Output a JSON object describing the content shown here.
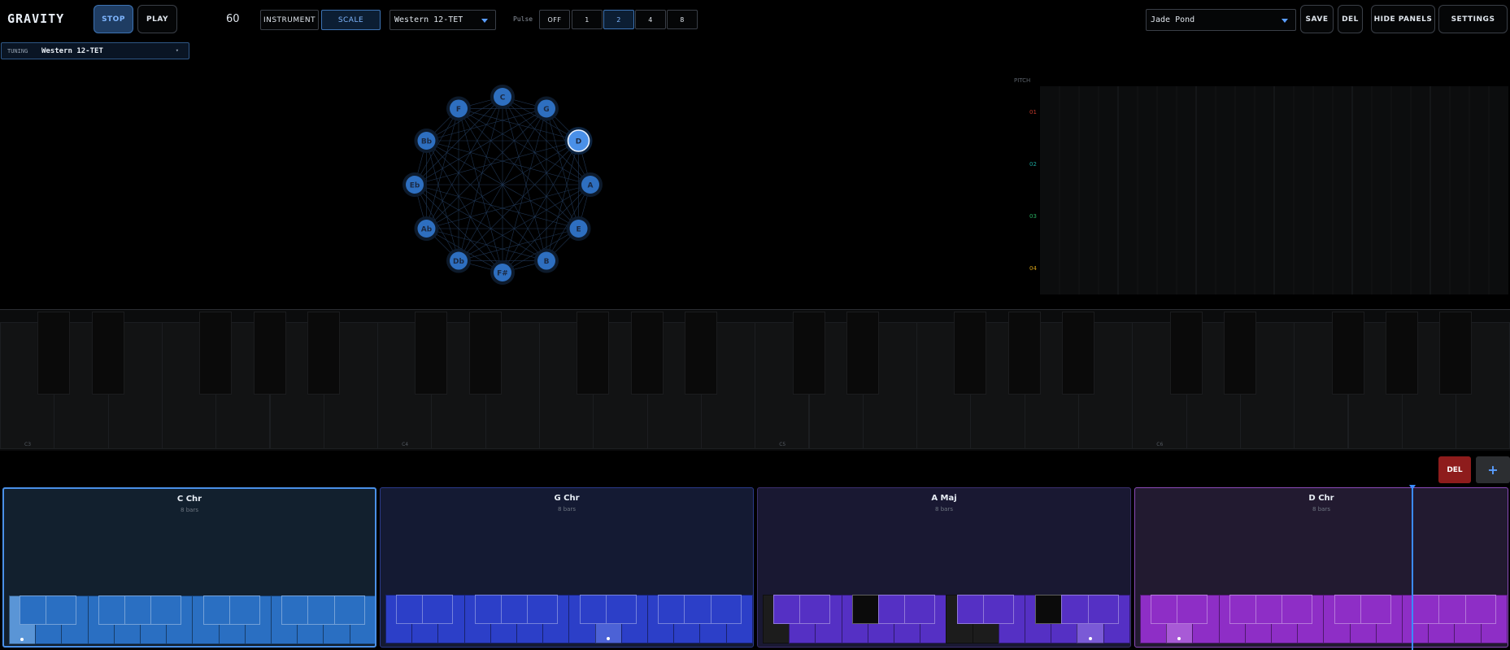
{
  "app": {
    "title": "GRAVITY"
  },
  "transport": {
    "stop_label": "STOP",
    "play_label": "PLAY",
    "tempo": "60"
  },
  "mode": {
    "instrument_label": "INSTRUMENT",
    "scale_label": "SCALE",
    "active": "SCALE"
  },
  "scale_select": {
    "value": "Western 12-TET"
  },
  "pulse": {
    "label": "Pulse",
    "options": [
      "OFF",
      "1",
      "2",
      "4",
      "8"
    ],
    "selected": "2"
  },
  "preset": {
    "value": "Jade Pond",
    "save_label": "SAVE",
    "del_label": "DEL"
  },
  "panels": {
    "hide_label": "HIDE PANELS",
    "settings_label": "SETTINGS"
  },
  "tuning": {
    "label": "TUNING",
    "value": "Western 12-TET",
    "arrow": "▾"
  },
  "circle": {
    "nodes": [
      "C",
      "G",
      "D",
      "A",
      "E",
      "B",
      "F#",
      "Db",
      "Ab",
      "Eb",
      "Bb",
      "F"
    ],
    "active": "D",
    "colors": {
      "node": "#2e6fc0",
      "active": "#4a90e8"
    }
  },
  "pitch_panel": {
    "title": "PITCH",
    "rows": [
      {
        "label": "01",
        "color": "#c0392b"
      },
      {
        "label": "02",
        "color": "#1aa39a"
      },
      {
        "label": "03",
        "color": "#27ae60"
      },
      {
        "label": "04",
        "color": "#d4a017"
      }
    ]
  },
  "keyboard": {
    "octave_labels": [
      "C3",
      "C4",
      "C5",
      "C6"
    ]
  },
  "chord_actions": {
    "del_label": "DEL",
    "add_label": "+"
  },
  "chords": [
    {
      "name": "C Chr",
      "sub": "8 bars",
      "accent": "#4a90e8",
      "bg": "#12202e",
      "key": "#2a6fc2",
      "key_light": "#5a95d6",
      "selected": true
    },
    {
      "name": "G Chr",
      "sub": "8 bars",
      "accent": "#2b3a8a",
      "bg": "#141a33",
      "key": "#2c3fc8",
      "key_light": "#4c62d6",
      "selected": false
    },
    {
      "name": "A Maj",
      "sub": "8 bars",
      "accent": "#3b2f6e",
      "bg": "#191832",
      "key": "#5530c4",
      "key_light": "#7a5ad6",
      "selected": false
    },
    {
      "name": "D Chr",
      "sub": "8 bars",
      "accent": "#8a4ab8",
      "bg": "#221a30",
      "key": "#8e2ec6",
      "key_light": "#a85ad6",
      "selected": false
    }
  ]
}
